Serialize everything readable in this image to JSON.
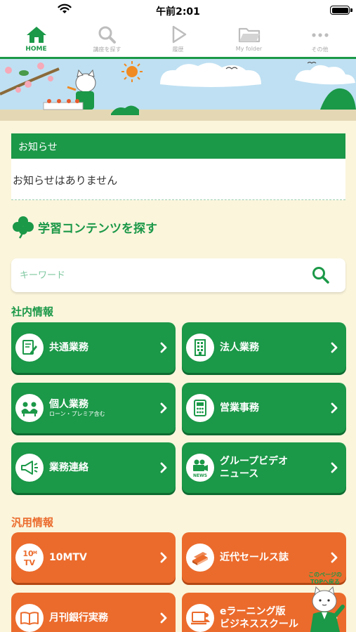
{
  "status": {
    "time": "午前2:01"
  },
  "tabs": [
    {
      "label": "HOME",
      "icon": "home-icon",
      "active": true
    },
    {
      "label": "講座を探す",
      "icon": "search-icon"
    },
    {
      "label": "履歴",
      "icon": "play-icon"
    },
    {
      "label": "My folder",
      "icon": "folder-icon"
    },
    {
      "label": "その他",
      "icon": "more-icon"
    }
  ],
  "notice": {
    "title": "お知らせ",
    "message": "お知らせはありません"
  },
  "learning": {
    "title": "学習コンテンツを探す",
    "search_placeholder": "キーワード"
  },
  "internal": {
    "title": "社内情報",
    "items": [
      {
        "label": "共通業務",
        "icon": "document-edit-icon"
      },
      {
        "label": "法人業務",
        "icon": "building-icon"
      },
      {
        "label": "個人業務",
        "sub": "ローン・プレミア含む",
        "icon": "consultation-icon"
      },
      {
        "label": "営業事務",
        "icon": "calculator-icon"
      },
      {
        "label": "業務連絡",
        "icon": "megaphone-icon"
      },
      {
        "label_line1": "グループビデオ",
        "label_line2": "ニュース",
        "icon": "news-camera-icon"
      }
    ]
  },
  "general": {
    "title": "汎用情報",
    "items": [
      {
        "label": "10MTV",
        "icon": "10mtv-logo-icon"
      },
      {
        "label": "近代セールス誌",
        "icon": "books-icon"
      },
      {
        "label": "月刊銀行実務",
        "icon": "open-book-icon"
      },
      {
        "label_line1": "eラーニング版",
        "label_line2": "ビジネススクール",
        "icon": "elearning-icon"
      }
    ]
  },
  "back_to_top": {
    "line1": "このページの",
    "line2": "TOPへ戻る"
  },
  "colors": {
    "green": "#1b9848",
    "orange": "#eb6b2c",
    "background": "#fbf5dc"
  }
}
